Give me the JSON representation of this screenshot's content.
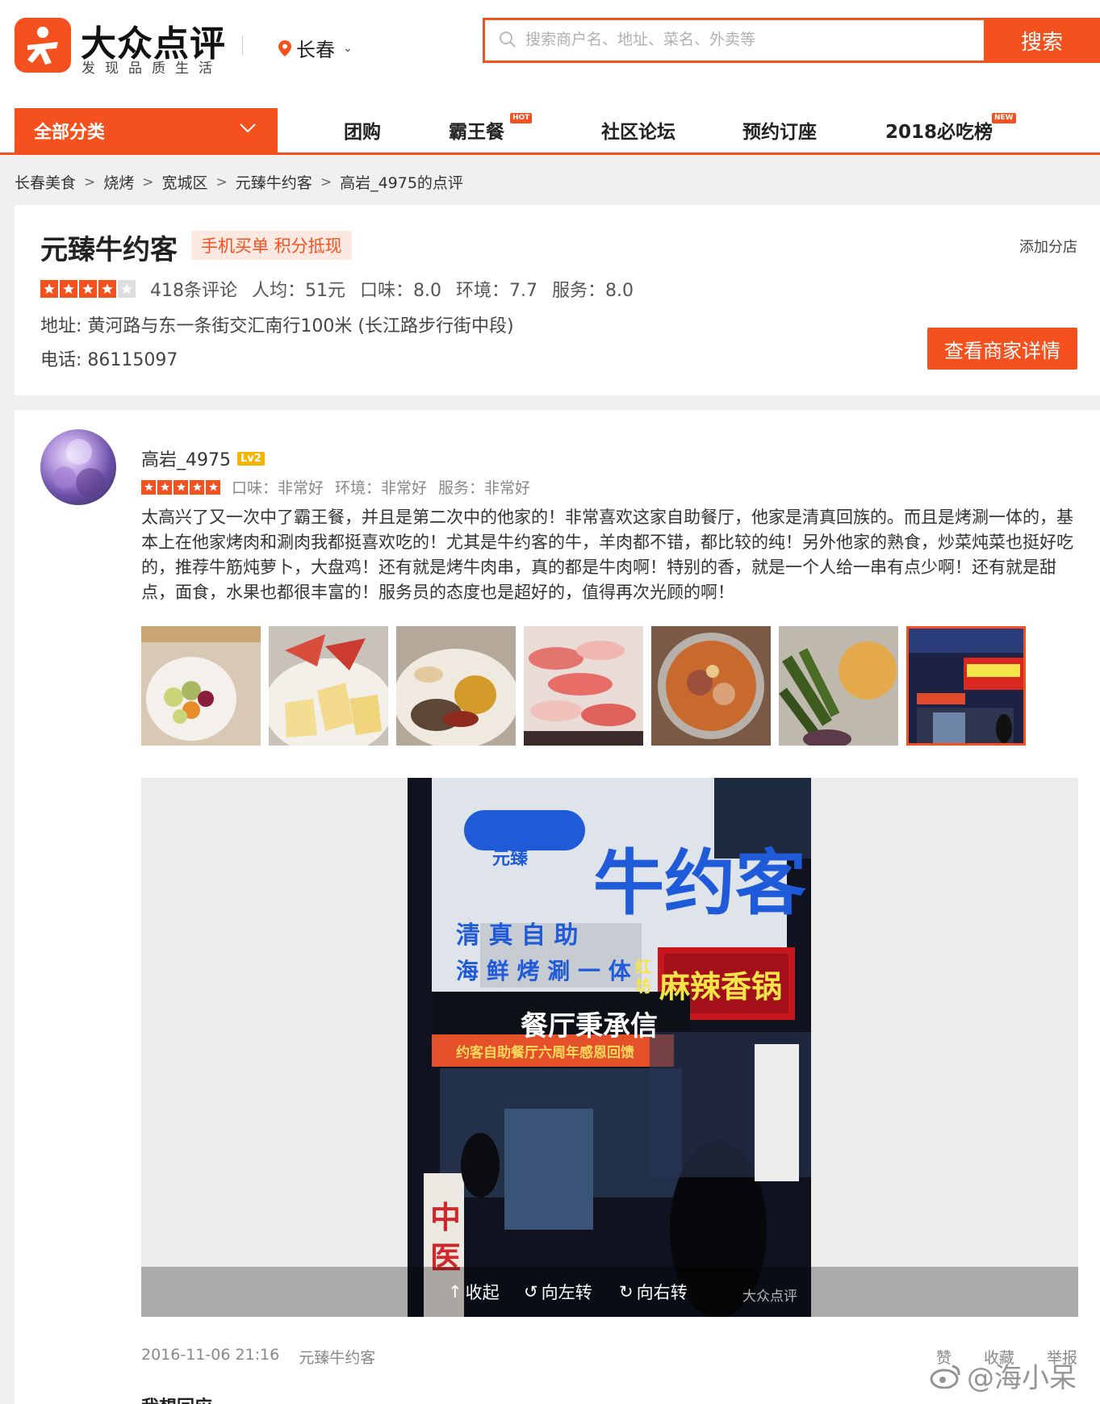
{
  "brand": {
    "name": "大众点评",
    "slogan": "发现品质生活",
    "color": "#f4511e"
  },
  "city": {
    "name": "长春"
  },
  "search": {
    "placeholder": "搜索商户名、地址、菜名、外卖等",
    "button": "搜索"
  },
  "nav": {
    "all_categories": "全部分类",
    "items": [
      {
        "label": "团购",
        "tag": ""
      },
      {
        "label": "霸王餐",
        "tag": "HOT"
      },
      {
        "label": "社区论坛",
        "tag": ""
      },
      {
        "label": "预约订座",
        "tag": ""
      },
      {
        "label": "2018必吃榜",
        "tag": "NEW"
      }
    ]
  },
  "breadcrumb": [
    "长春美食",
    "烧烤",
    "宽城区",
    "元臻牛约客",
    "高岩_4975的点评"
  ],
  "shop": {
    "name": "元臻牛约客",
    "promo": "手机买单 积分抵现",
    "add_branch": "添加分店",
    "stars": 4,
    "reviews": "418条评论",
    "avg_price": "人均：51元",
    "taste": "口味：8.0",
    "environment": "环境：7.7",
    "service": "服务：8.0",
    "address": "地址: 黄河路与东一条街交汇南行100米 (长江路步行街中段)",
    "phone": "电话: 86115097",
    "detail_button": "查看商家详情"
  },
  "review": {
    "username": "高岩_4975",
    "level": "Lv2",
    "stars": 5,
    "taste": "口味：非常好",
    "environment": "环境：非常好",
    "service": "服务：非常好",
    "text": "太高兴了又一次中了霸王餐，并且是第二次中的他家的！非常喜欢这家自助餐厅，他家是清真回族的。而且是烤涮一体的，基本上在他家烤肉和涮肉我都挺喜欢吃的！尤其是牛约客的牛，羊肉都不错，都比较的纯！另外他家的熟食，炒菜炖菜也挺好吃的，推荐牛筋炖萝卜，大盘鸡！还有就是烤牛肉串，真的都是牛肉啊！特别的香，就是一个人给一串有点少啊！还有就是甜点，面食，水果也都很丰富的！服务员的态度也是超好的，值得再次光顾的啊！",
    "photos": [
      "fruit-cup",
      "fruit-plate",
      "dishes",
      "meat-rolls",
      "hotpot",
      "vegetables",
      "storefront"
    ],
    "viewer": {
      "sign_main": "牛约客",
      "sign_small": "元臻",
      "sign_row1": "清 真 自 助",
      "sign_row2": "海 鲜 烤 涮 一 体",
      "sign_red": "麻辣香锅",
      "sign_red_small": "红坊",
      "sign_slogan": "餐厅秉承信",
      "banner": "约客自助餐厅六周年感恩回馈",
      "side_sign": "中医",
      "collapse": "收起",
      "rotate_left": "向左转",
      "rotate_right": "向右转",
      "watermark": "大众点评"
    },
    "datetime": "2016-11-06 21:16",
    "shop_link": "元臻牛约客",
    "actions": [
      "赞",
      "收藏",
      "举报"
    ],
    "reply_title": "我想回应"
  },
  "watermark": "@海小呆"
}
